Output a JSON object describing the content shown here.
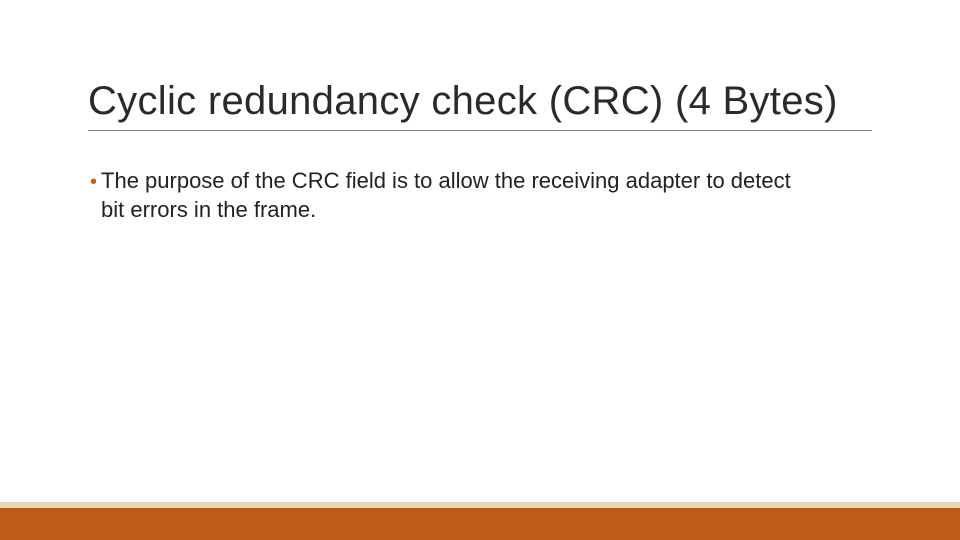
{
  "slide": {
    "title": "Cyclic redundancy check (CRC) (4 Bytes)",
    "bullets": [
      {
        "marker": "•",
        "text": "The purpose of the CRC field is to allow the receiving adapter to detect bit errors in the frame."
      }
    ]
  },
  "theme": {
    "footer_color": "#bf5b16",
    "accent_color": "#e8d7b2",
    "bullet_color": "#c05e12"
  }
}
